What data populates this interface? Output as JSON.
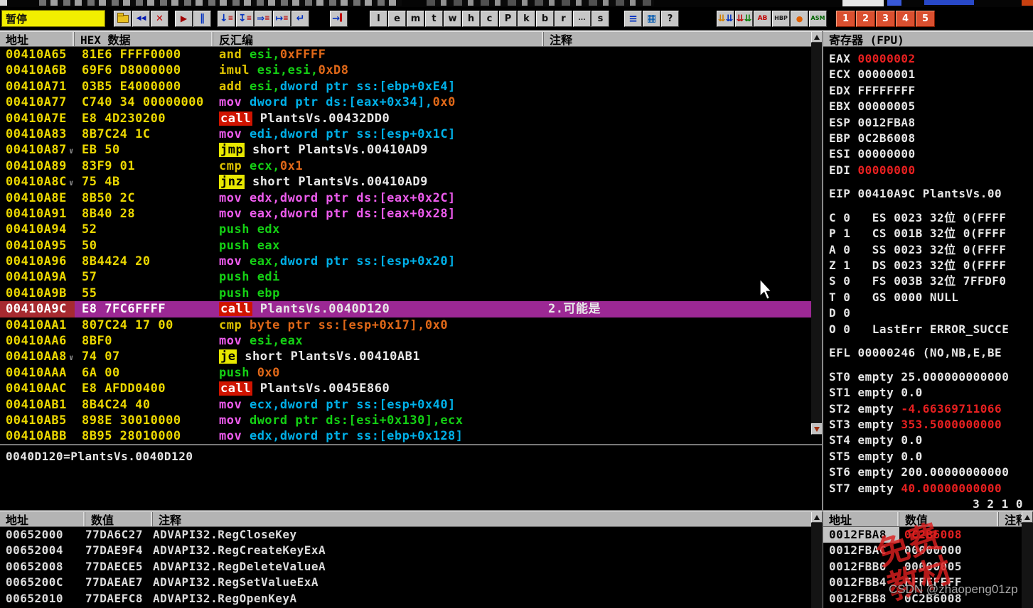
{
  "toolbar": {
    "status": "暂停",
    "buttons": [
      {
        "gap": 6
      },
      {
        "name": "open-file-button",
        "icon": "folder",
        "parts": []
      },
      {
        "name": "restart-button",
        "parts": [
          [
            "◀◀",
            "#0018b0",
            9
          ]
        ]
      },
      {
        "name": "close-program-button",
        "parts": [
          [
            "✕",
            "#c00000",
            13
          ]
        ]
      },
      {
        "gap": 8
      },
      {
        "name": "run-button",
        "parts": [
          [
            "▶",
            "#a00000",
            12
          ]
        ]
      },
      {
        "name": "pause-button",
        "parts": [
          [
            "‖",
            "#0030c0",
            14
          ]
        ]
      },
      {
        "gap": 8
      },
      {
        "name": "step-into-button",
        "parts": [
          [
            "↓",
            "#0030c0",
            14
          ],
          [
            "≡",
            "#c00000",
            9
          ]
        ]
      },
      {
        "name": "step-over-button",
        "parts": [
          [
            "↧",
            "#0030c0",
            14
          ],
          [
            "≡",
            "#c00000",
            9
          ]
        ]
      },
      {
        "name": "animate-into-button",
        "parts": [
          [
            "⇒",
            "#0030c0",
            13
          ],
          [
            "≡",
            "#c00000",
            9
          ]
        ]
      },
      {
        "name": "animate-over-button",
        "parts": [
          [
            "↦",
            "#0030c0",
            13
          ],
          [
            "≡",
            "#c00000",
            9
          ]
        ]
      },
      {
        "name": "execute-till-return-button",
        "parts": [
          [
            "↵",
            "#0030c0",
            14
          ]
        ]
      },
      {
        "gap": 28
      },
      {
        "name": "go-to-user-code-button",
        "parts": [
          [
            "→",
            "#0030c0",
            13
          ],
          [
            "▍",
            "#c00000",
            10
          ]
        ]
      },
      {
        "gap": 30
      },
      {
        "name": "letter-button-l",
        "cls": "letter",
        "parts": [
          [
            "l",
            "#101010",
            13
          ]
        ]
      },
      {
        "name": "letter-button-e",
        "cls": "letter",
        "parts": [
          [
            "e",
            "#101010",
            13
          ]
        ]
      },
      {
        "name": "letter-button-m",
        "cls": "letter",
        "parts": [
          [
            "m",
            "#101010",
            13
          ]
        ]
      },
      {
        "name": "letter-button-t",
        "cls": "letter",
        "parts": [
          [
            "t",
            "#101010",
            13
          ]
        ]
      },
      {
        "name": "letter-button-w",
        "cls": "letter",
        "parts": [
          [
            "w",
            "#101010",
            13
          ]
        ]
      },
      {
        "name": "letter-button-h",
        "cls": "letter",
        "parts": [
          [
            "h",
            "#101010",
            13
          ]
        ]
      },
      {
        "name": "letter-button-c",
        "cls": "letter",
        "parts": [
          [
            "c",
            "#101010",
            13
          ]
        ]
      },
      {
        "name": "letter-button-P",
        "cls": "letter",
        "parts": [
          [
            "P",
            "#101010",
            13
          ]
        ]
      },
      {
        "name": "letter-button-k",
        "cls": "letter",
        "parts": [
          [
            "k",
            "#101010",
            13
          ]
        ]
      },
      {
        "name": "letter-button-b",
        "cls": "letter",
        "parts": [
          [
            "b",
            "#101010",
            13
          ]
        ]
      },
      {
        "name": "letter-button-r",
        "cls": "letter",
        "parts": [
          [
            "r",
            "#101010",
            13
          ]
        ]
      },
      {
        "name": "letter-button-dots",
        "cls": "letter",
        "parts": [
          [
            "...",
            "#101010",
            9
          ]
        ]
      },
      {
        "name": "letter-button-s",
        "cls": "letter",
        "parts": [
          [
            "s",
            "#101010",
            13
          ]
        ]
      },
      {
        "gap": 20
      },
      {
        "name": "log-window-button",
        "parts": [
          [
            "≡",
            "#0030c0",
            15
          ]
        ]
      },
      {
        "name": "windows-list-button",
        "parts": [
          [
            "▦",
            "#0058b0",
            14
          ]
        ]
      },
      {
        "name": "help-button",
        "parts": [
          [
            "?",
            "#101010",
            13
          ]
        ]
      },
      {
        "gap": 52
      },
      {
        "name": "run-trace-plugin-button",
        "parts": [
          [
            "⇊",
            "#d08000",
            13
          ],
          [
            "⇊",
            "#0030c0",
            13
          ]
        ]
      },
      {
        "name": "hit-trace-plugin-button",
        "parts": [
          [
            "⇊",
            "#c00000",
            13
          ],
          [
            "⇊",
            "#008000",
            13
          ]
        ]
      },
      {
        "name": "ab-plugin-button",
        "parts": [
          [
            "AB",
            "#c00000",
            9
          ]
        ]
      },
      {
        "name": "hbp-plugin-button",
        "parts": [
          [
            "HBP",
            "#202020",
            8
          ]
        ]
      },
      {
        "name": "dot-plugin-button",
        "parts": [
          [
            "●",
            "#e06000",
            11
          ]
        ]
      },
      {
        "name": "asm-plugin-button",
        "parts": [
          [
            "ASM",
            "#006400",
            8
          ]
        ]
      },
      {
        "gap": 12
      },
      {
        "name": "desktop-button-1",
        "cls": "num",
        "parts": [
          [
            "1",
            "#ffffff",
            13
          ]
        ]
      },
      {
        "name": "desktop-button-2",
        "cls": "num",
        "parts": [
          [
            "2",
            "#ffffff",
            13
          ]
        ]
      },
      {
        "name": "desktop-button-3",
        "cls": "num",
        "parts": [
          [
            "3",
            "#ffffff",
            13
          ]
        ]
      },
      {
        "name": "desktop-button-4",
        "cls": "num",
        "parts": [
          [
            "4",
            "#ffffff",
            13
          ]
        ]
      },
      {
        "name": "desktop-button-5",
        "cls": "num",
        "parts": [
          [
            "5",
            "#ffffff",
            13
          ]
        ]
      }
    ]
  },
  "disasm": {
    "headers": {
      "addr": "地址",
      "hex": "HEX 数据",
      "dis": "反汇编",
      "com": "注释"
    },
    "rows": [
      {
        "a": "00410A65",
        "h": "81E6 FFFF0000",
        "t": [
          [
            "and ",
            "y"
          ],
          [
            "esi,",
            "g"
          ],
          [
            "0xFFFF",
            "o"
          ]
        ]
      },
      {
        "a": "00410A6B",
        "h": "69F6 D8000000",
        "t": [
          [
            "imul ",
            "y"
          ],
          [
            "esi,esi,",
            "g"
          ],
          [
            "0xD8",
            "o"
          ]
        ]
      },
      {
        "a": "00410A71",
        "h": "03B5 E4000000",
        "t": [
          [
            "add ",
            "y"
          ],
          [
            "esi,",
            "g"
          ],
          [
            "dword ptr ss:[ebp+0xE4]",
            "c"
          ]
        ]
      },
      {
        "a": "00410A77",
        "h": "C740 34 00000000",
        "t": [
          [
            "mov ",
            "m"
          ],
          [
            "dword ptr ds:[eax+0x34],",
            "c"
          ],
          [
            "0x0",
            "o"
          ]
        ]
      },
      {
        "a": "00410A7E",
        "h": "E8 4D230200",
        "t": [
          [
            "call",
            "rb"
          ],
          [
            " PlantsVs.00432DD0",
            "w"
          ]
        ]
      },
      {
        "a": "00410A83",
        "h": "8B7C24 1C",
        "t": [
          [
            "mov ",
            "m"
          ],
          [
            "edi,",
            "c"
          ],
          [
            "dword ptr ss:[esp+0x1C]",
            "c"
          ]
        ]
      },
      {
        "a": "00410A87",
        "mark": true,
        "h": "EB 50",
        "t": [
          [
            "jmp",
            "yb"
          ],
          [
            " short PlantsVs.00410AD9",
            "w"
          ]
        ]
      },
      {
        "a": "00410A89",
        "h": "83F9 01",
        "t": [
          [
            "cmp ",
            "y"
          ],
          [
            "ecx,",
            "g"
          ],
          [
            "0x1",
            "o"
          ]
        ]
      },
      {
        "a": "00410A8C",
        "mark": true,
        "h": "75 4B",
        "t": [
          [
            "jnz",
            "yb"
          ],
          [
            " short PlantsVs.00410AD9",
            "w"
          ]
        ]
      },
      {
        "a": "00410A8E",
        "h": "8B50 2C",
        "t": [
          [
            "mov ",
            "m"
          ],
          [
            "edx,dword ptr ds:[eax+0x2C]",
            "m"
          ]
        ]
      },
      {
        "a": "00410A91",
        "h": "8B40 28",
        "t": [
          [
            "mov ",
            "m"
          ],
          [
            "eax,dword ptr ds:[eax+0x28]",
            "m"
          ]
        ]
      },
      {
        "a": "00410A94",
        "h": "52",
        "t": [
          [
            "push ",
            "g"
          ],
          [
            "edx",
            "g"
          ]
        ]
      },
      {
        "a": "00410A95",
        "h": "50",
        "t": [
          [
            "push ",
            "g"
          ],
          [
            "eax",
            "g"
          ]
        ]
      },
      {
        "a": "00410A96",
        "h": "8B4424 20",
        "t": [
          [
            "mov ",
            "m"
          ],
          [
            "eax,",
            "g"
          ],
          [
            "dword ptr ss:[esp+0x20]",
            "c"
          ]
        ]
      },
      {
        "a": "00410A9A",
        "h": "57",
        "t": [
          [
            "push ",
            "g"
          ],
          [
            "edi",
            "g"
          ]
        ]
      },
      {
        "a": "00410A9B",
        "h": "55",
        "t": [
          [
            "push ",
            "g"
          ],
          [
            "ebp",
            "g"
          ]
        ]
      },
      {
        "a": "00410A9C",
        "h": "E8 7FC6FFFF",
        "t": [
          [
            "call",
            "rb"
          ],
          [
            " PlantsVs.0040D120",
            "w"
          ]
        ],
        "c": "2.可能是",
        "hl": true
      },
      {
        "a": "00410AA1",
        "h": "807C24 17 00",
        "t": [
          [
            "cmp ",
            "y"
          ],
          [
            "byte ptr ss:[esp+0x17],",
            "o"
          ],
          [
            "0x0",
            "o"
          ]
        ]
      },
      {
        "a": "00410AA6",
        "h": "8BF0",
        "t": [
          [
            "mov ",
            "m"
          ],
          [
            "esi,eax",
            "g"
          ]
        ]
      },
      {
        "a": "00410AA8",
        "mark": true,
        "h": "74 07",
        "t": [
          [
            "je",
            "yb"
          ],
          [
            " short PlantsVs.00410AB1",
            "w"
          ]
        ]
      },
      {
        "a": "00410AAA",
        "h": "6A 00",
        "t": [
          [
            "push ",
            "g"
          ],
          [
            "0x0",
            "o"
          ]
        ]
      },
      {
        "a": "00410AAC",
        "h": "E8 AFDD0400",
        "t": [
          [
            "call",
            "rb"
          ],
          [
            " PlantsVs.0045E860",
            "w"
          ]
        ]
      },
      {
        "a": "00410AB1",
        "h": "8B4C24 40",
        "t": [
          [
            "mov ",
            "m"
          ],
          [
            "ecx,",
            "c"
          ],
          [
            "dword ptr ss:[esp+0x40]",
            "c"
          ]
        ]
      },
      {
        "a": "00410AB5",
        "h": "898E 30010000",
        "t": [
          [
            "mov ",
            "m"
          ],
          [
            "dword ptr ds:[esi+0x130],ecx",
            "g"
          ]
        ]
      },
      {
        "a": "00410ABB",
        "h": "8B95 28010000",
        "t": [
          [
            "mov ",
            "m"
          ],
          [
            "edx,dword ptr ss:[ebp+0x128]",
            "c"
          ]
        ]
      }
    ]
  },
  "info_pane": {
    "line": "0040D120=PlantsVs.0040D120"
  },
  "registers": {
    "title": "寄存器 (FPU)",
    "lines": [
      {
        "parts": [
          [
            "EAX ",
            "w"
          ],
          [
            "00000002",
            "r"
          ]
        ]
      },
      {
        "parts": [
          [
            "ECX ",
            "w"
          ],
          [
            "00000001",
            "w"
          ]
        ]
      },
      {
        "parts": [
          [
            "EDX ",
            "w"
          ],
          [
            "FFFFFFFF",
            "w"
          ]
        ]
      },
      {
        "parts": [
          [
            "EBX ",
            "w"
          ],
          [
            "00000005",
            "w"
          ]
        ]
      },
      {
        "parts": [
          [
            "ESP ",
            "w"
          ],
          [
            "0012FBA8",
            "w"
          ]
        ]
      },
      {
        "parts": [
          [
            "EBP ",
            "w"
          ],
          [
            "0C2B6008",
            "w"
          ]
        ]
      },
      {
        "parts": [
          [
            "ESI ",
            "w"
          ],
          [
            "00000000",
            "w"
          ]
        ]
      },
      {
        "parts": [
          [
            "EDI ",
            "w"
          ],
          [
            "00000000",
            "r"
          ]
        ]
      },
      {
        "blank": true
      },
      {
        "parts": [
          [
            "EIP ",
            "w"
          ],
          [
            "00410A9C PlantsVs.00",
            "w"
          ]
        ]
      },
      {
        "blank": true
      },
      {
        "parts": [
          [
            "C 0   ES 0023 32位 0(FFFF",
            "w"
          ]
        ]
      },
      {
        "parts": [
          [
            "P 1   CS 001B 32位 0(FFFF",
            "w"
          ]
        ]
      },
      {
        "parts": [
          [
            "A 0   SS 0023 32位 0(FFFF",
            "w"
          ]
        ]
      },
      {
        "parts": [
          [
            "Z 1   DS 0023 32位 0(FFFF",
            "w"
          ]
        ]
      },
      {
        "parts": [
          [
            "S 0   FS 003B 32位 7FFDF0",
            "w"
          ]
        ]
      },
      {
        "parts": [
          [
            "T 0   GS 0000 NULL",
            "w"
          ]
        ]
      },
      {
        "parts": [
          [
            "D 0",
            "w"
          ]
        ]
      },
      {
        "parts": [
          [
            "O 0   LastErr ERROR_SUCCE",
            "w"
          ]
        ]
      },
      {
        "blank": true
      },
      {
        "parts": [
          [
            "EFL 00000246 (NO,NB,E,BE",
            "w"
          ]
        ]
      },
      {
        "blank": true
      },
      {
        "parts": [
          [
            "ST0 empty 25.000000000000",
            "w"
          ]
        ]
      },
      {
        "parts": [
          [
            "ST1 empty 0.0",
            "w"
          ]
        ]
      },
      {
        "parts": [
          [
            "ST2 empty ",
            "w"
          ],
          [
            "-4.66369711066",
            "r"
          ]
        ]
      },
      {
        "parts": [
          [
            "ST3 empty ",
            "w"
          ],
          [
            "353.5000000000",
            "r"
          ]
        ]
      },
      {
        "parts": [
          [
            "ST4 empty 0.0",
            "w"
          ]
        ]
      },
      {
        "parts": [
          [
            "ST5 empty 0.0",
            "w"
          ]
        ]
      },
      {
        "parts": [
          [
            "ST6 empty 200.00000000000",
            "w"
          ]
        ]
      },
      {
        "parts": [
          [
            "ST7 empty ",
            "w"
          ],
          [
            "40.00000000000",
            "r"
          ]
        ]
      },
      {
        "parts": [
          [
            "3 2 1 0",
            "w"
          ]
        ],
        "align": "right"
      }
    ]
  },
  "dump": {
    "headers": {
      "addr": "地址",
      "val": "数值",
      "com": "注释"
    },
    "rows": [
      {
        "addr": "00652000",
        "value": "77DA6C27",
        "comment": "ADVAPI32.RegCloseKey"
      },
      {
        "addr": "00652004",
        "value": "77DAE9F4",
        "comment": "ADVAPI32.RegCreateKeyExA"
      },
      {
        "addr": "00652008",
        "value": "77DAECE5",
        "comment": "ADVAPI32.RegDeleteValueA"
      },
      {
        "addr": "0065200C",
        "value": "77DAEAE7",
        "comment": "ADVAPI32.RegSetValueExA"
      },
      {
        "addr": "00652010",
        "value": "77DAEFC8",
        "comment": "ADVAPI32.RegOpenKeyA"
      }
    ]
  },
  "stack": {
    "headers": {
      "addr": "地址",
      "val": "数值",
      "com": "注释"
    },
    "rows": [
      {
        "addr": "0012FBA8",
        "value": "0C2B6008",
        "sel": true,
        "red": true
      },
      {
        "addr": "0012FBAC",
        "value": "00000000"
      },
      {
        "addr": "0012FBB0",
        "value": "00000005"
      },
      {
        "addr": "0012FBB4",
        "value": "FFFFFFFF"
      },
      {
        "addr": "0012FBB8",
        "value": "0C2B6008"
      }
    ]
  },
  "watermarks": {
    "csdn": "CSDN @zhaopeng01zp",
    "red_text": "免费\n教材"
  }
}
